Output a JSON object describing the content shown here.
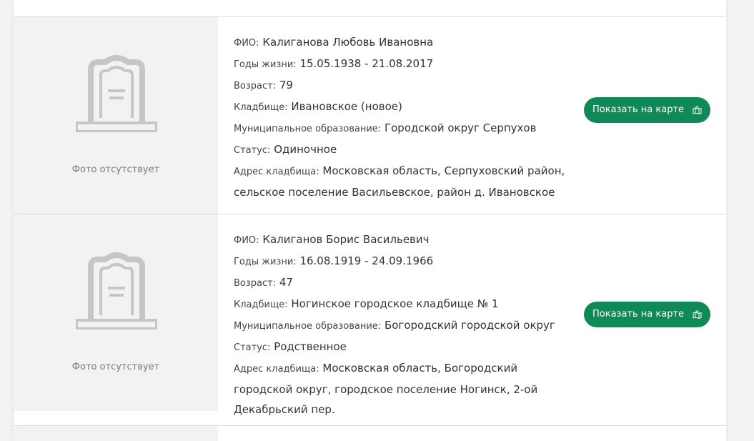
{
  "records": [
    {
      "fio_label": "ФИО:",
      "fio": "Калиганова Любовь Ивановна",
      "years_label": "Годы жизни:",
      "years": "15.05.1938 - 21.08.2017",
      "age_label": "Возраст:",
      "age": "79",
      "cemetery_label": "Кладбище:",
      "cemetery": "Ивановское (новое)",
      "municipality_label": "Муниципальное образование:",
      "municipality": "Городской округ Серпухов",
      "status_label": "Статус:",
      "status": "Одиночное",
      "address_label": "Адрес кладбища:",
      "address_line1": "Московская область, Серпуховский район,",
      "address_line2": "сельское поселение Васильевское, район д. Ивановское",
      "no_photo": "Фото отсутствует",
      "map_button": "Показать на карте"
    },
    {
      "fio_label": "ФИО:",
      "fio": "Калиганов Борис Васильевич",
      "years_label": "Годы жизни:",
      "years": "16.08.1919 - 24.09.1966",
      "age_label": "Возраст:",
      "age": "47",
      "cemetery_label": "Кладбище:",
      "cemetery": "Ногинское городское кладбище № 1",
      "municipality_label": "Муниципальное образование:",
      "municipality": "Богородский городской округ",
      "status_label": "Статус:",
      "status": "Родственное",
      "address_label": "Адрес кладбища:",
      "address_line1": "Московская область, Богородский",
      "address_line2": "городской округ, городское поселение Ногинск, 2-ой",
      "address_line3": "Декабрьский пер.",
      "no_photo": "Фото отсутствует",
      "map_button": "Показать на карте"
    }
  ],
  "colors": {
    "accent": "#0f8a57",
    "placeholder_bg": "#f2f2f2",
    "icon_gray": "#c6c6c6"
  },
  "icons": {
    "placeholder": "tombstone-icon",
    "map": "map-icon"
  }
}
